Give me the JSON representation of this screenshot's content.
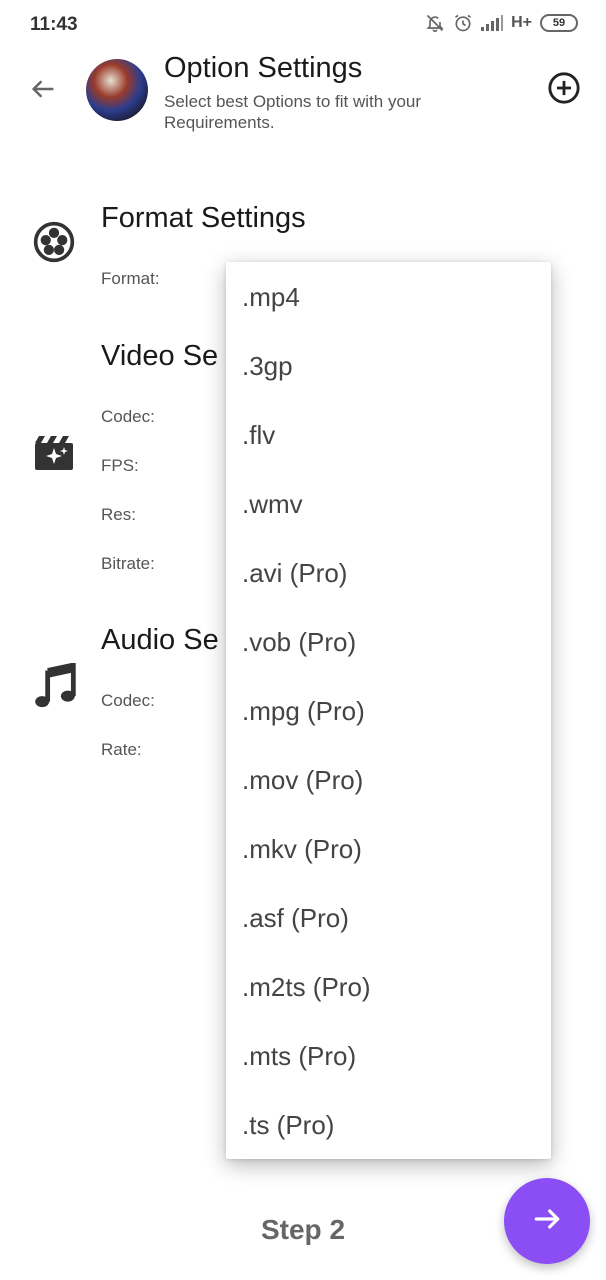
{
  "status_bar": {
    "time": "11:43",
    "network": "H+",
    "battery": "59"
  },
  "header": {
    "title": "Option Settings",
    "subtitle": "Select best Options to fit with your Requirements."
  },
  "format_section": {
    "title": "Format Settings",
    "format_label": "Format:"
  },
  "video_section": {
    "title": "Video Se",
    "codec_label": "Codec:",
    "fps_label": "FPS:",
    "res_label": "Res:",
    "bitrate_label": "Bitrate:"
  },
  "audio_section": {
    "title": "Audio Se",
    "codec_label": "Codec:",
    "rate_label": "Rate:"
  },
  "dropdown": {
    "options": [
      ".mp4",
      ".3gp",
      ".flv",
      ".wmv",
      ".avi (Pro)",
      ".vob (Pro)",
      ".mpg (Pro)",
      ".mov (Pro)",
      ".mkv (Pro)",
      ".asf (Pro)",
      ".m2ts (Pro)",
      ".mts (Pro)",
      ".ts (Pro)"
    ]
  },
  "footer": {
    "step_label": "Step 2"
  },
  "colors": {
    "accent": "#8b4ef5",
    "text_primary": "#1a1a1a",
    "text_secondary": "#555555"
  },
  "icons": {
    "back": "arrow-left-icon",
    "add": "add-circle-icon",
    "format": "film-reel-icon",
    "video": "movie-sparkle-icon",
    "audio": "music-note-icon",
    "next": "arrow-right-icon"
  }
}
